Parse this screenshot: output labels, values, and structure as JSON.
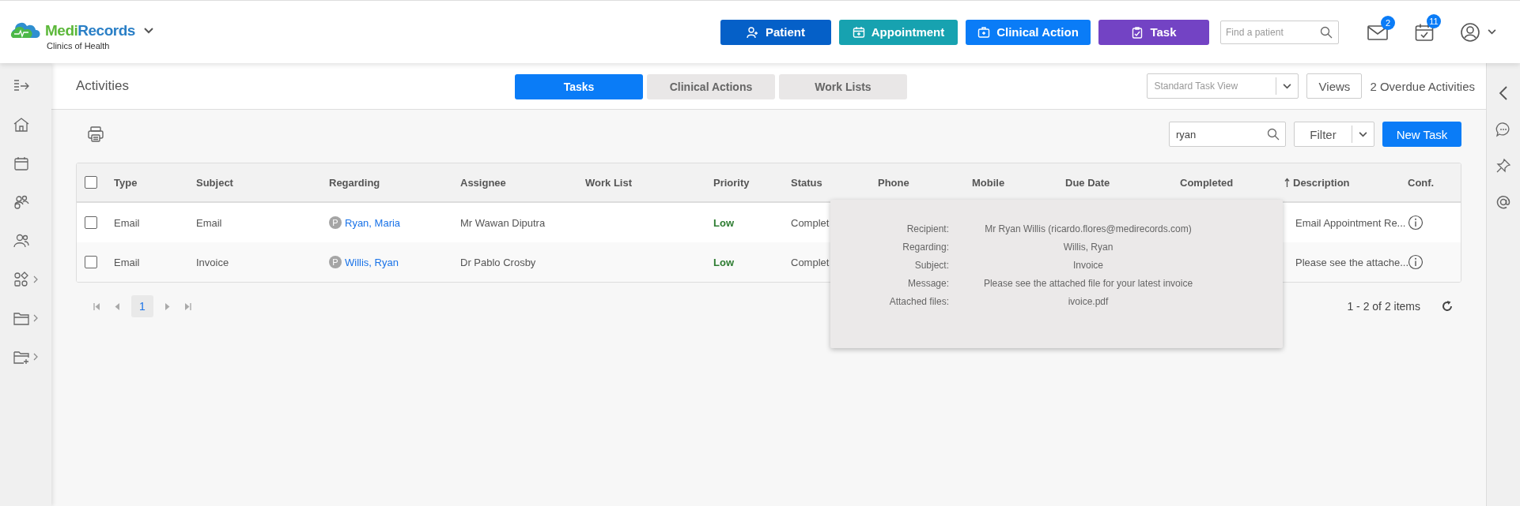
{
  "header": {
    "brand": {
      "name_part1": "Medi",
      "name_part2": "Records",
      "clinic": "Clinics of Health"
    },
    "actions": [
      {
        "label": "Patient",
        "color": "#0560c8"
      },
      {
        "label": "Appointment",
        "color": "#17a2b0"
      },
      {
        "label": "Clinical Action",
        "color": "#0a7cf7"
      },
      {
        "label": "Task",
        "color": "#7343c4"
      }
    ],
    "search": {
      "placeholder": "Find a patient"
    },
    "mail_badge": "2",
    "calendar_badge": "11"
  },
  "page": {
    "title": "Activities",
    "tabs": [
      {
        "label": "Tasks",
        "selected": true
      },
      {
        "label": "Clinical Actions",
        "selected": false
      },
      {
        "label": "Work Lists",
        "selected": false
      }
    ],
    "view_select": {
      "placeholder": "Standard Task View"
    },
    "views_button": "Views",
    "overdue": "2 Overdue Activities"
  },
  "toolbar": {
    "search": {
      "value": "ryan"
    },
    "filter": "Filter",
    "new_task": "New Task"
  },
  "table": {
    "select_all_checked": false,
    "columns": [
      {
        "label": "Type",
        "sorted": false
      },
      {
        "label": "Subject",
        "sorted": false
      },
      {
        "label": "Regarding",
        "sorted": false
      },
      {
        "label": "Assignee",
        "sorted": false
      },
      {
        "label": "Work List",
        "sorted": false
      },
      {
        "label": "Priority",
        "sorted": false
      },
      {
        "label": "Status",
        "sorted": false
      },
      {
        "label": "Phone",
        "sorted": false
      },
      {
        "label": "Mobile",
        "sorted": false
      },
      {
        "label": "Due Date",
        "sorted": false
      },
      {
        "label": "Completed",
        "sorted": false
      },
      {
        "label": "Description",
        "sorted": true
      },
      {
        "label": "Conf.",
        "sorted": false
      }
    ],
    "rows": [
      {
        "checked": false,
        "type": "Email",
        "subject": "Email",
        "regarding_badge": "P",
        "regarding": "Ryan, Maria",
        "assignee": "Mr Wawan Diputra",
        "priority": "Low",
        "status": "Complet",
        "description": "Email Appointment Re..."
      },
      {
        "checked": false,
        "type": "Email",
        "subject": "Invoice",
        "regarding_badge": "P",
        "regarding": "Willis, Ryan",
        "assignee": "Dr Pablo Crosby",
        "priority": "Low",
        "status": "Complet",
        "description": "Please see the attache..."
      }
    ],
    "pagination": {
      "page": "1",
      "summary": "1 - 2 of 2 items"
    }
  },
  "tooltip": {
    "rows": [
      {
        "label": "Recipient:",
        "value": "Mr Ryan Willis (ricardo.flores@medirecords.com)"
      },
      {
        "label": "Regarding:",
        "value": "Willis, Ryan"
      },
      {
        "label": "Subject:",
        "value": "Invoice"
      },
      {
        "label": "Message:",
        "value": "Please see the attached file for your latest invoice"
      },
      {
        "label": "Attached files:",
        "value": "ivoice.pdf"
      }
    ]
  }
}
